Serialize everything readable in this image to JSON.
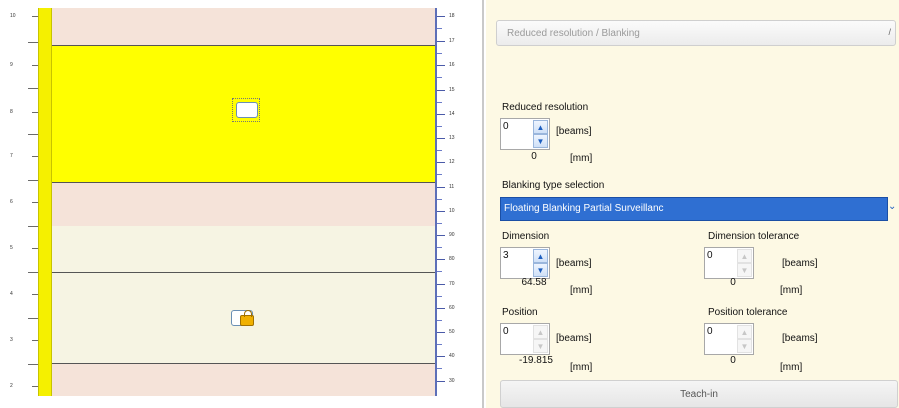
{
  "field": {
    "left_scale": [
      "10",
      "9",
      "8",
      "7",
      "6",
      "5",
      "4",
      "3",
      "2"
    ],
    "right_scale": [
      "18",
      "17",
      "16",
      "15",
      "14",
      "13",
      "12",
      "11",
      "10",
      "90",
      "80",
      "70",
      "60",
      "50",
      "40",
      "30"
    ],
    "colors": {
      "yellow_zone": "#ffff00",
      "peach_zone": "#f5e3d9",
      "cream_zone": "#f6f4e3",
      "bar": "#f5f000",
      "ruler": "#5d6fb8"
    },
    "icons": [
      "object-icon",
      "lock-icon"
    ]
  },
  "panel": {
    "section": "Reduced resolution / Blanking",
    "reduced_resolution": {
      "label": "Reduced resolution",
      "beams_value": "0",
      "unit": "[beams]",
      "mm_value": "0",
      "mm_unit": "[mm]"
    },
    "blanking_type": {
      "label": "Blanking type selection",
      "selected": "Floating Blanking Partial Surveillanc"
    },
    "dimension": {
      "label": "Dimension",
      "beams_value": "3",
      "unit": "[beams]",
      "mm_value": "64.58",
      "mm_unit": "[mm]"
    },
    "dimension_tolerance": {
      "label": "Dimension tolerance",
      "beams_value": "0",
      "unit": "[beams]",
      "mm_value": "0",
      "mm_unit": "[mm]"
    },
    "position": {
      "label": "Position",
      "beams_value": "0",
      "unit": "[beams]",
      "mm_value": "-19.815",
      "mm_unit": "[mm]"
    },
    "position_tolerance": {
      "label": "Position tolerance",
      "beams_value": "0",
      "unit": "[beams]",
      "mm_value": "0",
      "mm_unit": "[mm]"
    },
    "teach_in": "Teach-in"
  }
}
